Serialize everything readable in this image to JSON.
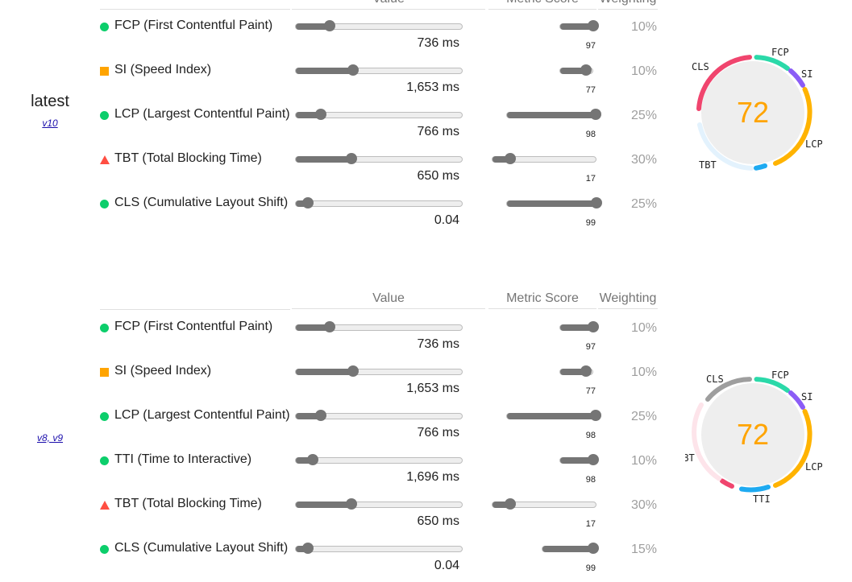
{
  "sections": [
    {
      "label": "latest",
      "link": "v10",
      "headers": {
        "value": "Value",
        "score": "Metric Score",
        "weight": "Weighting"
      },
      "metrics": [
        {
          "status": "pass",
          "name": "FCP (First Contentful Paint)",
          "value": "736 ms",
          "score": "97",
          "weight": "10%",
          "value_level": 0.2,
          "score_level": 0.97
        },
        {
          "status": "average",
          "name": "SI (Speed Index)",
          "value": "1,653 ms",
          "score": "77",
          "weight": "10%",
          "value_level": 0.34,
          "score_level": 0.77
        },
        {
          "status": "pass",
          "name": "LCP (Largest Contentful Paint)",
          "value": "766 ms",
          "score": "98",
          "weight": "25%",
          "value_level": 0.15,
          "score_level": 0.98
        },
        {
          "status": "fail",
          "name": "TBT (Total Blocking Time)",
          "value": "650 ms",
          "score": "17",
          "weight": "30%",
          "value_level": 0.33,
          "score_level": 0.17
        },
        {
          "status": "pass",
          "name": "CLS (Cumulative Layout Shift)",
          "value": "0.04",
          "score": "99",
          "weight": "25%",
          "value_level": 0.07,
          "score_level": 0.99
        }
      ],
      "gauge": {
        "score": "72",
        "labels": {
          "fcp": "FCP",
          "si": "SI",
          "lcp": "LCP",
          "tbt": "TBT",
          "cls": "CLS"
        }
      }
    },
    {
      "label": "",
      "link": "v8, v9",
      "headers": {
        "value": "Value",
        "score": "Metric Score",
        "weight": "Weighting"
      },
      "metrics": [
        {
          "status": "pass",
          "name": "FCP (First Contentful Paint)",
          "value": "736 ms",
          "score": "97",
          "weight": "10%",
          "value_level": 0.2,
          "score_level": 0.97
        },
        {
          "status": "average",
          "name": "SI (Speed Index)",
          "value": "1,653 ms",
          "score": "77",
          "weight": "10%",
          "value_level": 0.34,
          "score_level": 0.77
        },
        {
          "status": "pass",
          "name": "LCP (Largest Contentful Paint)",
          "value": "766 ms",
          "score": "98",
          "weight": "25%",
          "value_level": 0.15,
          "score_level": 0.98
        },
        {
          "status": "pass",
          "name": "TTI (Time to Interactive)",
          "value": "1,696 ms",
          "score": "98",
          "weight": "10%",
          "value_level": 0.1,
          "score_level": 0.98
        },
        {
          "status": "fail",
          "name": "TBT (Total Blocking Time)",
          "value": "650 ms",
          "score": "17",
          "weight": "30%",
          "value_level": 0.33,
          "score_level": 0.17
        },
        {
          "status": "pass",
          "name": "CLS (Cumulative Layout Shift)",
          "value": "0.04",
          "score": "99",
          "weight": "15%",
          "value_level": 0.07,
          "score_level": 0.99
        }
      ],
      "gauge": {
        "score": "72",
        "labels": {
          "fcp": "FCP",
          "si": "SI",
          "lcp": "LCP",
          "tti": "TTI",
          "tbt": "TBT",
          "cls": "CLS"
        }
      }
    }
  ],
  "colors": {
    "pass": "#0cce6b",
    "average": "#ffa400",
    "fail": "#ff4e42",
    "fcp": "#2bd9a9",
    "si": "#8b5cf6",
    "lcp": "#ffb300",
    "tti": "#1eaaf1",
    "tbt": "#e8f5fe",
    "cls": "#f0456e",
    "cls_v8": "#9e9e9e",
    "tbt_v8": "#f0456e"
  }
}
